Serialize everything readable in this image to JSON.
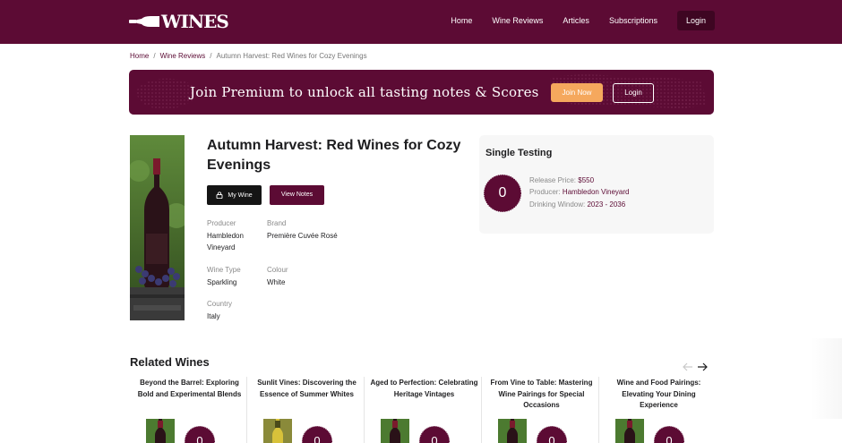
{
  "header": {
    "logo_text": "WINES",
    "nav": [
      "Home",
      "Wine Reviews",
      "Articles",
      "Subscriptions"
    ],
    "login_label": "Login"
  },
  "breadcrumb": {
    "home": "Home",
    "sep1": "/",
    "section": "Wine Reviews",
    "sep2": "/",
    "current": "Autumn Harvest: Red Wines for Cozy Evenings"
  },
  "banner": {
    "text": "Join Premium to unlock all tasting notes & Scores",
    "join_label": "Join Now",
    "login_label": "Login",
    "color": "#5c0b34",
    "accent": "#f5a85d"
  },
  "product": {
    "title": "Autumn Harvest: Red Wines for Cozy Evenings",
    "my_wine_label": "My Wine",
    "view_notes_label": "View Notes",
    "fields": {
      "producer_label": "Producer",
      "producer": "Hambledon Vineyard",
      "brand_label": "Brand",
      "brand": "Première Cuvée Rosé",
      "wine_type_label": "Wine Type",
      "wine_type": "Sparkling",
      "colour_label": "Colour",
      "colour": "White",
      "country_label": "Country",
      "country": "Italy"
    }
  },
  "testing": {
    "title": "Single Testing",
    "score": "0",
    "release_price_label": "Release Price:",
    "release_price": "$550",
    "producer_label": "Producer:",
    "producer": "Hambledon Vineyard",
    "drinking_window_label": "Drinking Window:",
    "drinking_window": "2023 - 2036"
  },
  "related": {
    "title": "Related Wines",
    "items": [
      {
        "title": "Beyond the Barrel: Exploring Bold and Experimental Blends",
        "score": "0",
        "thumb": "red-bottle"
      },
      {
        "title": "Sunlit Vines: Discovering the Essence of Summer Whites",
        "score": "0",
        "thumb": "white-bottle"
      },
      {
        "title": "Aged to Perfection: Celebrating Heritage Vintages",
        "score": "0",
        "thumb": "red-bottle"
      },
      {
        "title": "From Vine to Table: Mastering Wine Pairings for Special Occasions",
        "score": "0",
        "thumb": "red-bottle"
      },
      {
        "title": "Wine and Food Pairings: Elevating Your Dining Experience",
        "score": "0",
        "thumb": "red-bottle"
      }
    ]
  },
  "colors": {
    "brand": "#5c0b34",
    "dark_button": "#151515"
  }
}
